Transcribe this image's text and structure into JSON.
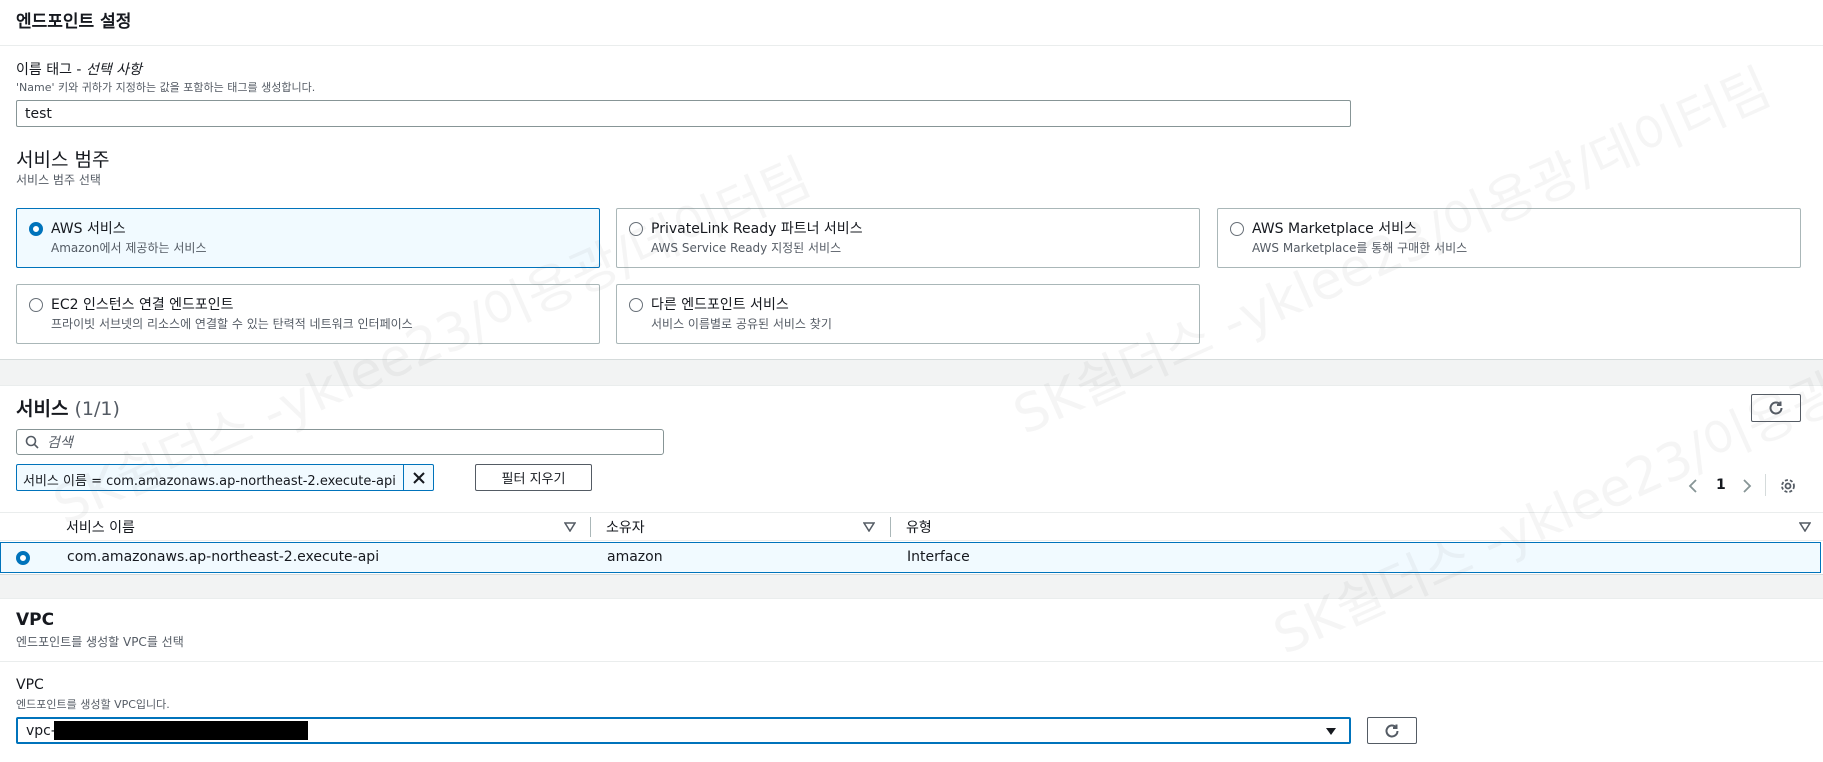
{
  "endpoint_settings": {
    "title": "엔드포인트 설정",
    "name_tag": {
      "label": "이름 태그 - ",
      "label_optional": "선택 사항",
      "description": "'Name' 키와 귀하가 지정하는 값을 포함하는 태그를 생성합니다.",
      "value": "test"
    },
    "category": {
      "title": "서비스 범주",
      "subtitle": "서비스 범주 선택",
      "options": [
        {
          "title": "AWS 서비스",
          "desc": "Amazon에서 제공하는 서비스",
          "selected": true
        },
        {
          "title": "PrivateLink Ready 파트너 서비스",
          "desc": "AWS Service Ready 지정된 서비스",
          "selected": false
        },
        {
          "title": "AWS Marketplace 서비스",
          "desc": "AWS Marketplace를 통해 구매한 서비스",
          "selected": false
        },
        {
          "title": "EC2 인스턴스 연결 엔드포인트",
          "desc": "프라이빗 서브넷의 리소스에 연결할 수 있는 탄력적 네트워크 인터페이스",
          "selected": false
        },
        {
          "title": "다른 엔드포인트 서비스",
          "desc": "서비스 이름별로 공유된 서비스 찾기",
          "selected": false
        }
      ]
    }
  },
  "services": {
    "title": "서비스",
    "count": "(1/1)",
    "search_placeholder": "검색",
    "filter_token": "서비스 이름 = com.amazonaws.ap-northeast-2.execute-api",
    "clear_filters_label": "필터 지우기",
    "page": "1",
    "columns": [
      "서비스 이름",
      "소유자",
      "유형"
    ],
    "rows": [
      {
        "name": "com.amazonaws.ap-northeast-2.execute-api",
        "owner": "amazon",
        "type": "Interface",
        "selected": true
      }
    ]
  },
  "vpc": {
    "title": "VPC",
    "subtitle": "엔드포인트를 생성할 VPC를 선택",
    "field_label": "VPC",
    "field_desc": "엔드포인트를 생성할 VPC입니다.",
    "value_prefix": "vpc-"
  },
  "watermark_text": "SK쉴더스 -yklee23/이용광/데이터팀",
  "colors": {
    "accent": "#0073bb",
    "border": "#aab7b8",
    "page_bg": "#f2f3f3"
  },
  "icons": [
    "x-icon",
    "refresh-icon",
    "chevron-left-icon",
    "chevron-right-icon",
    "gear-icon",
    "search-icon",
    "caret-down-icon",
    "sort-icon"
  ]
}
